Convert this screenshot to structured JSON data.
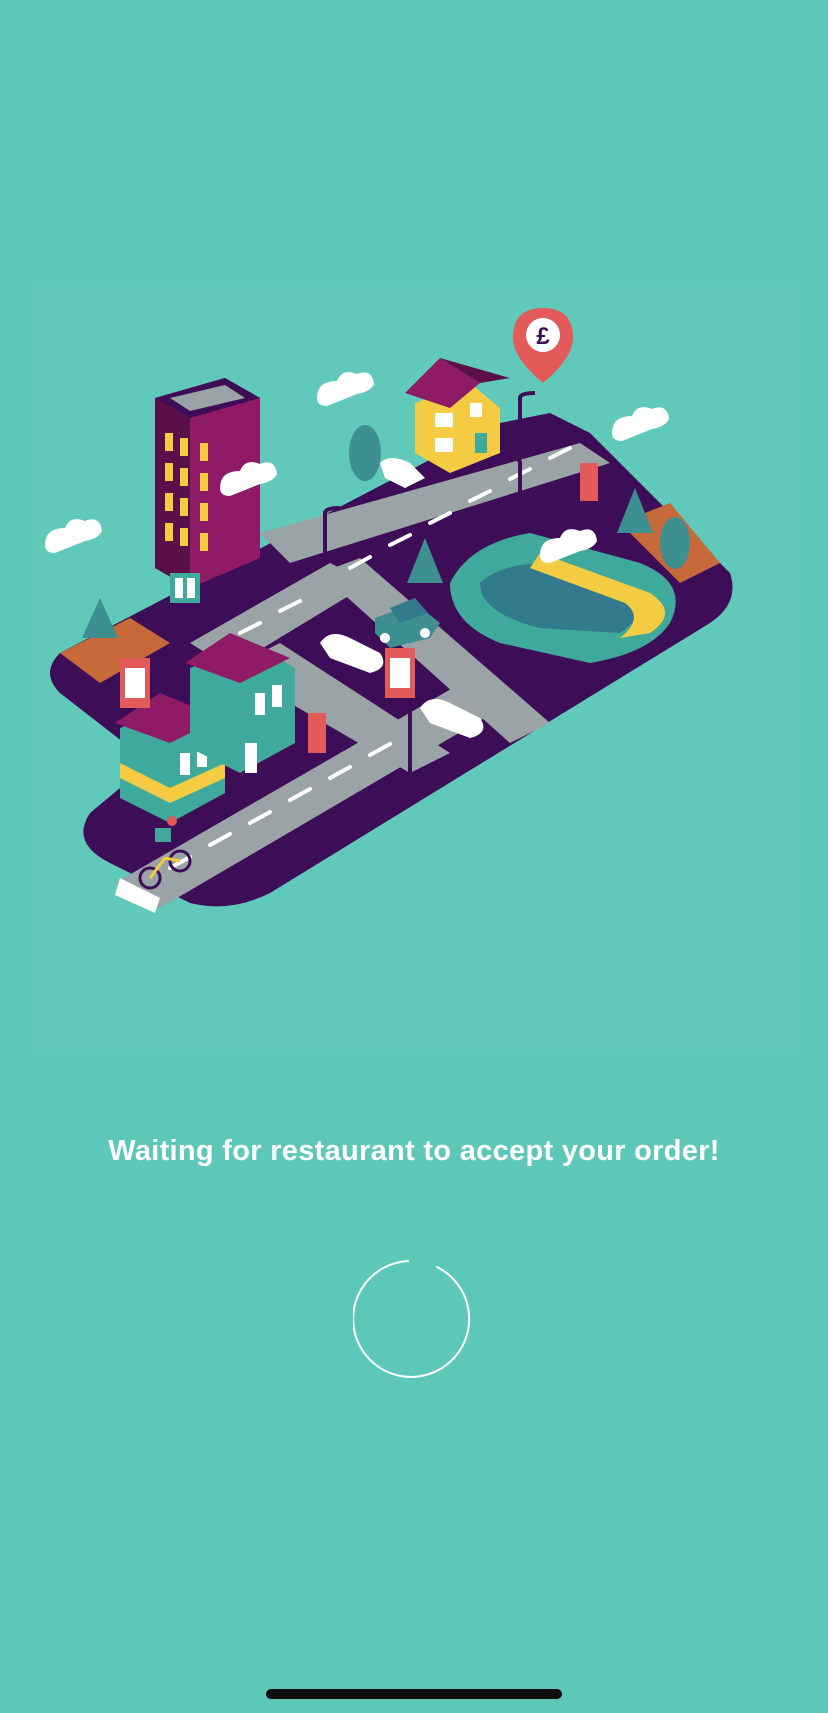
{
  "screen": {
    "background_color": "#5DC8B8",
    "accent_color": "#3E0D57"
  },
  "illustration": {
    "map_pin_symbol": "£",
    "icon": "city-delivery-illustration"
  },
  "status": {
    "message": "Waiting for restaurant to accept your order!"
  },
  "loading": {
    "icon": "loading-spinner-icon"
  }
}
